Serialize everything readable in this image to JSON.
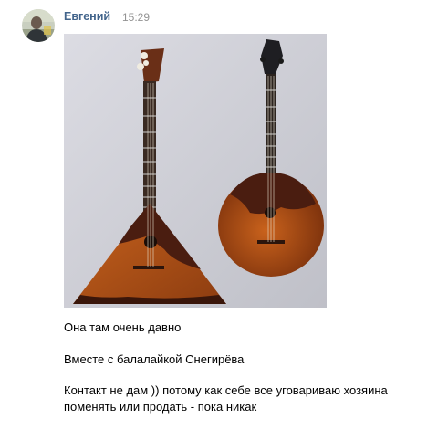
{
  "message": {
    "author": "Евгений",
    "time": "15:29",
    "lines": [
      "Она там очень давно",
      "Вместе с балалайкой Снегирёва",
      "Контакт не дам )) потому как себе все уговариваю хозяина",
      "поменять или продать - пока никак"
    ]
  },
  "colors": {
    "author_link": "#42648b",
    "timestamp": "#939393",
    "text": "#000000"
  },
  "icons": {
    "avatar": "user-avatar-photo"
  }
}
